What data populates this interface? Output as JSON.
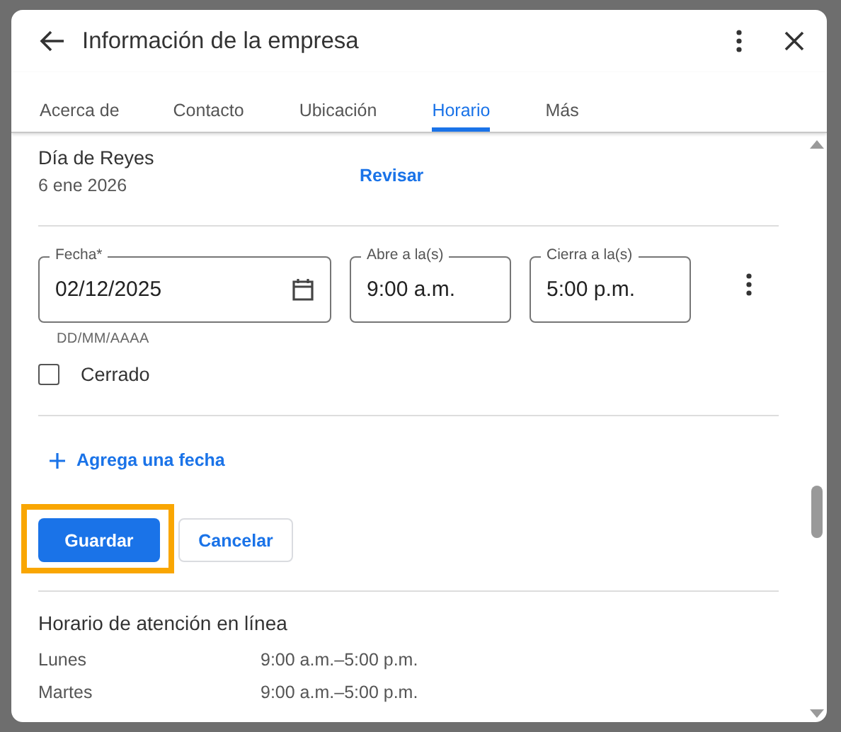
{
  "dialog": {
    "title": "Información de la empresa"
  },
  "tabs": [
    {
      "label": "Acerca de",
      "selected": false
    },
    {
      "label": "Contacto",
      "selected": false
    },
    {
      "label": "Ubicación",
      "selected": false
    },
    {
      "label": "Horario",
      "selected": true
    },
    {
      "label": "Más",
      "selected": false
    }
  ],
  "holiday": {
    "name": "Día de Reyes",
    "date": "6 ene 2026",
    "action": "Revisar"
  },
  "fields": [
    {
      "kind": "date",
      "label": "Fecha*",
      "value": "02/12/2025",
      "helper": "DD/MM/AAAA"
    },
    {
      "kind": "time",
      "label": "Abre a la(s)",
      "value": "9:00 a.m."
    },
    {
      "kind": "time",
      "label": "Cierra a la(s)",
      "value": "5:00 p.m."
    }
  ],
  "closed": {
    "label": "Cerrado",
    "checked": false
  },
  "add_date": {
    "label": "Agrega una fecha"
  },
  "actions": [
    {
      "kind": "primary",
      "label": "Guardar",
      "highlighted": true
    },
    {
      "kind": "secondary",
      "label": "Cancelar",
      "highlighted": false
    }
  ],
  "online_hours": {
    "title": "Horario de atención en línea",
    "rows": [
      {
        "day": "Lunes",
        "hours": "9:00 a.m.–5:00 p.m."
      },
      {
        "day": "Martes",
        "hours": "9:00 a.m.–5:00 p.m."
      }
    ]
  }
}
